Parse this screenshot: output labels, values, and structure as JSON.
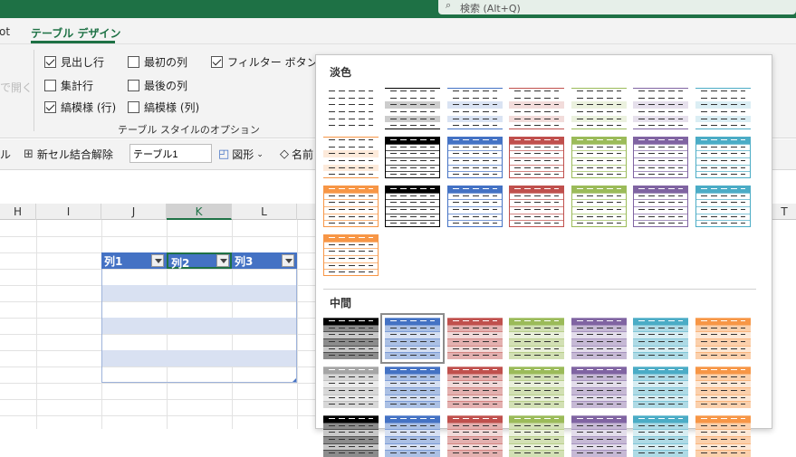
{
  "search": {
    "text": "検索 (Alt+Q)"
  },
  "menu": {
    "tab_prev": "ot",
    "tab_active": "テーブル デザイン"
  },
  "ribbon": {
    "open_label": "で開く",
    "options": [
      {
        "label": "見出し行",
        "checked": true
      },
      {
        "label": "最初の列",
        "checked": false
      },
      {
        "label": "フィルター ボタン",
        "checked": true
      },
      {
        "label": "集計行",
        "checked": false
      },
      {
        "label": "最後の列",
        "checked": false
      },
      {
        "label": "縞模様 (行)",
        "checked": true
      },
      {
        "label": "縞模様 (列)",
        "checked": false
      }
    ],
    "group_label": "テーブル スタイルのオプション"
  },
  "toolbar": {
    "cut_label": "ル",
    "unmerge_label": "新セル結合解除",
    "table_name": "テーブル1",
    "shapes_label": "図形",
    "name_label": "名前"
  },
  "sheet": {
    "columns": [
      "H",
      "I",
      "J",
      "K",
      "L"
    ],
    "last_column": "T",
    "selected_column": "K",
    "table_headers": [
      "列1",
      "列2",
      "列3"
    ]
  },
  "gallery": {
    "section_light": "淡色",
    "section_medium": "中間",
    "colors": {
      "none": "#7f7f7f",
      "black": "#000000",
      "blue": "#4472c4",
      "red": "#c0504d",
      "green": "#9bbb59",
      "purple": "#8064a2",
      "teal": "#4bacc6",
      "orange": "#f79646",
      "gray": "#a5a5a5"
    }
  }
}
